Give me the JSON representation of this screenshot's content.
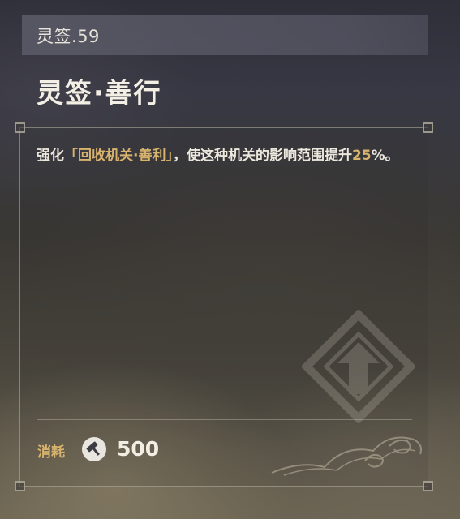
{
  "header": {
    "level_label": "灵签.59"
  },
  "card": {
    "title": "灵签·善行"
  },
  "description": {
    "prefix": "强化",
    "highlight_name": "「回收机关·善利」",
    "middle": "，使这种机关的影响范围提升",
    "highlight_value": "25",
    "suffix": "%。"
  },
  "cost": {
    "label": "消耗",
    "icon": "hammer-icon",
    "value": "500"
  },
  "colors": {
    "highlight": "#d7b36e",
    "text": "#ece8dd"
  }
}
